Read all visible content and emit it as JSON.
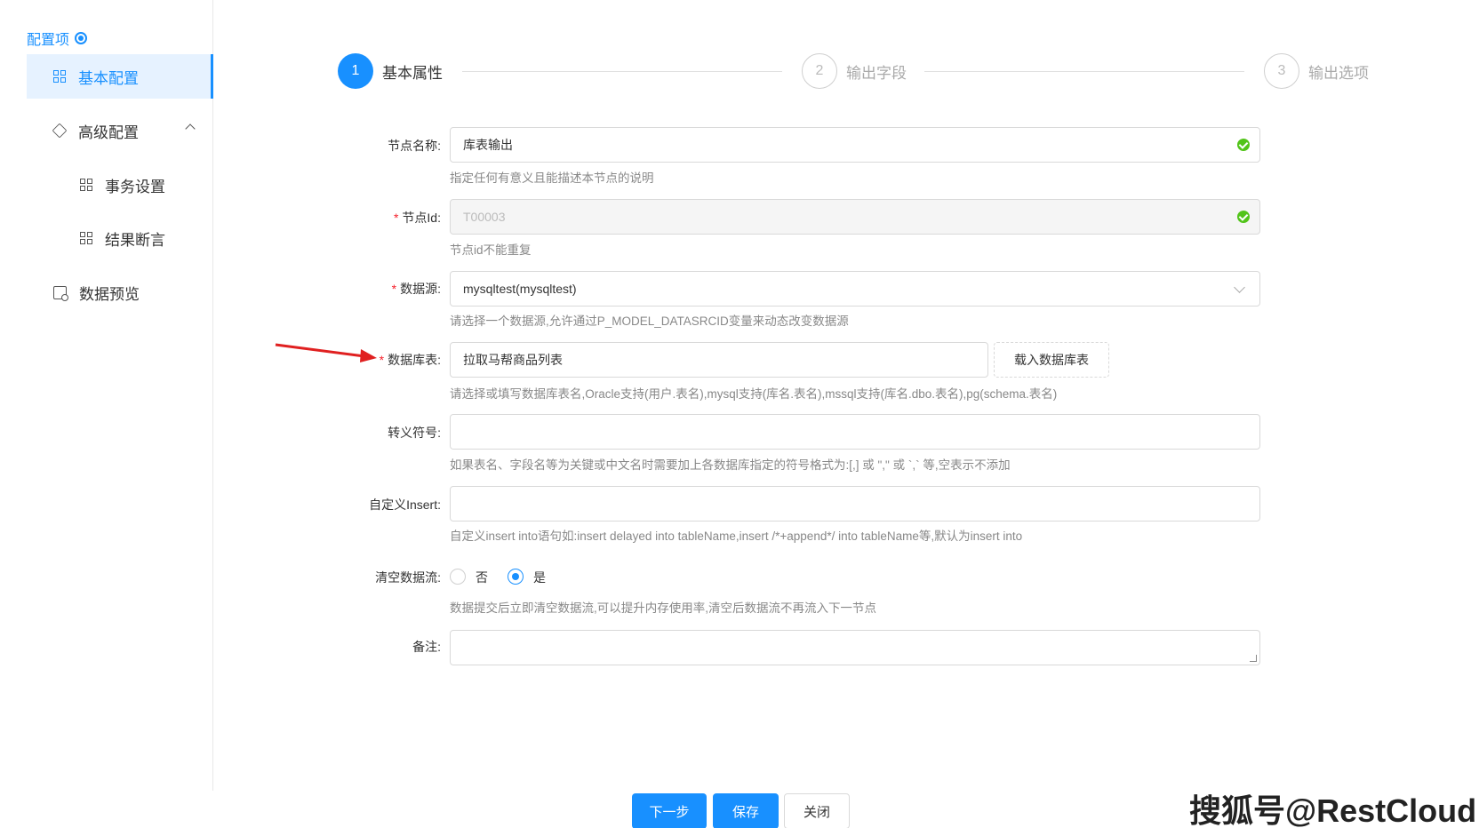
{
  "sidebar": {
    "title": "配置项",
    "items": [
      {
        "label": "基本配置"
      },
      {
        "label": "高级配置"
      },
      {
        "label": "事务设置"
      },
      {
        "label": "结果断言"
      },
      {
        "label": "数据预览"
      }
    ]
  },
  "steps": [
    {
      "number": "1",
      "label": "基本属性"
    },
    {
      "number": "2",
      "label": "输出字段"
    },
    {
      "number": "3",
      "label": "输出选项"
    }
  ],
  "form": {
    "node_name": {
      "label": "节点名称:",
      "value": "库表输出",
      "hint": "指定任何有意义且能描述本节点的说明"
    },
    "node_id": {
      "label": "节点Id:",
      "value": "T00003",
      "hint": "节点id不能重复"
    },
    "datasource": {
      "label": "数据源:",
      "value": "mysqltest(mysqltest)",
      "hint": "请选择一个数据源,允许通过P_MODEL_DATASRCID变量来动态改变数据源"
    },
    "table": {
      "label": "数据库表:",
      "value": "拉取马帮商品列表",
      "button": "载入数据库表",
      "hint": "请选择或填写数据库表名,Oracle支持(用户.表名),mysql支持(库名.表名),mssql支持(库名.dbo.表名),pg(schema.表名)"
    },
    "escape": {
      "label": "转义符号:",
      "value": "",
      "hint": "如果表名、字段名等为关键或中文名时需要加上各数据库指定的符号格式为:[,] 或 \",\" 或 `,` 等,空表示不添加"
    },
    "insert": {
      "label": "自定义Insert:",
      "value": "",
      "hint": "自定义insert into语句如:insert delayed into tableName,insert /*+append*/ into tableName等,默认为insert into"
    },
    "clear_stream": {
      "label": "清空数据流:",
      "option_no": "否",
      "option_yes": "是",
      "selected": "是",
      "hint": "数据提交后立即清空数据流,可以提升内存使用率,清空后数据流不再流入下一节点"
    },
    "remark": {
      "label": "备注:",
      "value": ""
    }
  },
  "footer": {
    "next": "下一步",
    "save": "保存",
    "close": "关闭"
  },
  "watermark": "搜狐号@RestCloud",
  "colors": {
    "primary": "#1890ff",
    "success": "#52c41a",
    "required": "#f5222d",
    "annotation_arrow": "#e02020"
  }
}
